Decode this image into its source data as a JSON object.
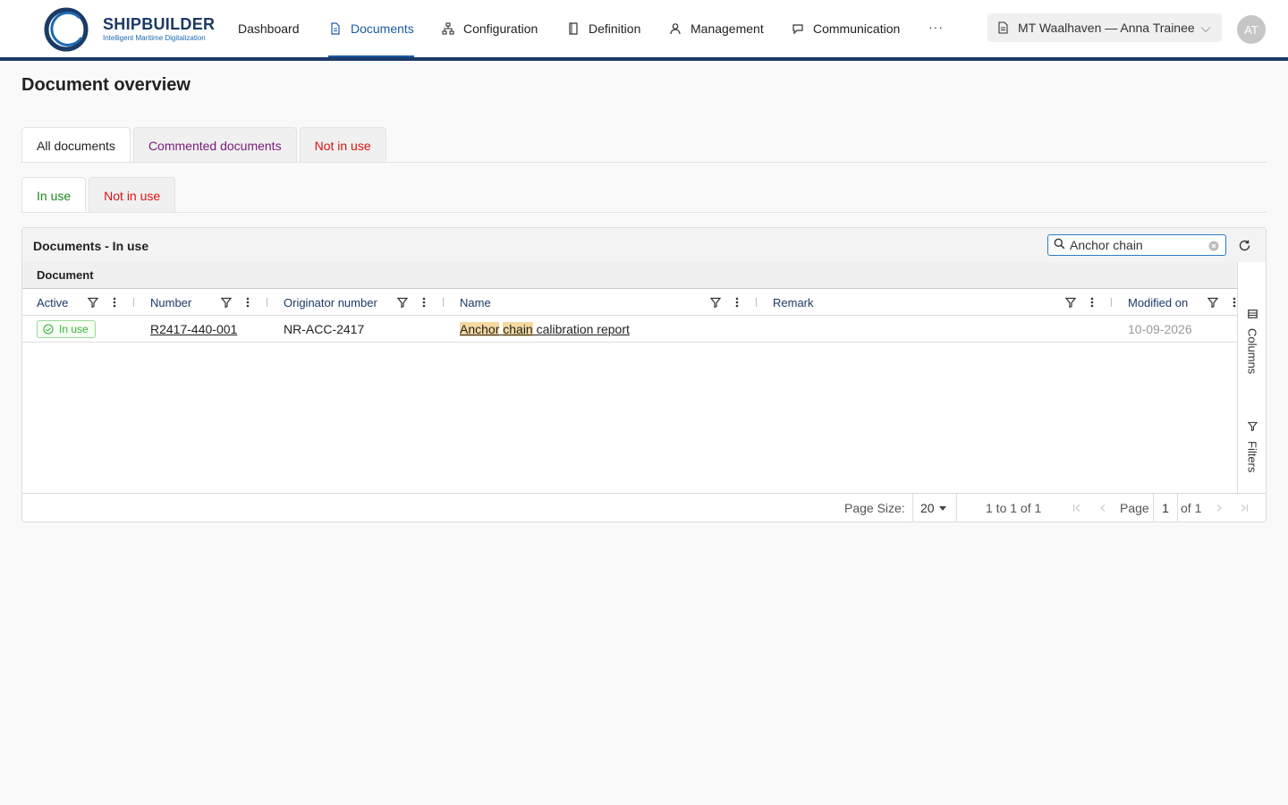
{
  "app": {
    "logo_title": "SHIPBUILDER",
    "logo_subtitle": "Intelligent Maritime Digitalization",
    "accent": "#1b3a66",
    "link_color": "#1b5aa6"
  },
  "nav": {
    "items": [
      {
        "label": "Dashboard",
        "icon": "none"
      },
      {
        "label": "Documents",
        "icon": "document-icon",
        "active": true
      },
      {
        "label": "Configuration",
        "icon": "sitemap-icon"
      },
      {
        "label": "Definition",
        "icon": "book-icon"
      },
      {
        "label": "Management",
        "icon": "user-icon"
      },
      {
        "label": "Communication",
        "icon": "chat-icon"
      }
    ],
    "more": "···",
    "context": "MT Waalhaven — Anna Trainee",
    "avatar": "AT"
  },
  "page": {
    "title": "Document overview"
  },
  "tabs_primary": [
    {
      "label": "All documents",
      "active": true
    },
    {
      "label": "Commented documents"
    },
    {
      "label": "Not in use"
    }
  ],
  "tabs_secondary": [
    {
      "label": "In use",
      "active": true
    },
    {
      "label": "Not in use"
    }
  ],
  "panel": {
    "title": "Documents - In use",
    "search_value": "Anchor chain",
    "group_label": "Document"
  },
  "columns": {
    "active": "Active",
    "number": "Number",
    "originator": "Originator number",
    "name": "Name",
    "remark": "Remark",
    "modified": "Modified on"
  },
  "rows": [
    {
      "active": "In use",
      "number": "R2417-440-001",
      "originator": "NR-ACC-2417",
      "name_hl1": "Anchor",
      "name_mid": " ",
      "name_hl2": "chain",
      "name_rest": " calibration report",
      "remark": "",
      "modified": "10-09-2026"
    }
  ],
  "side": {
    "columns": "Columns",
    "filters": "Filters"
  },
  "pagination": {
    "page_size_label": "Page Size:",
    "page_size": "20",
    "range": "1 to 1 of 1",
    "page_label": "Page",
    "page": "1",
    "of": "of 1"
  }
}
